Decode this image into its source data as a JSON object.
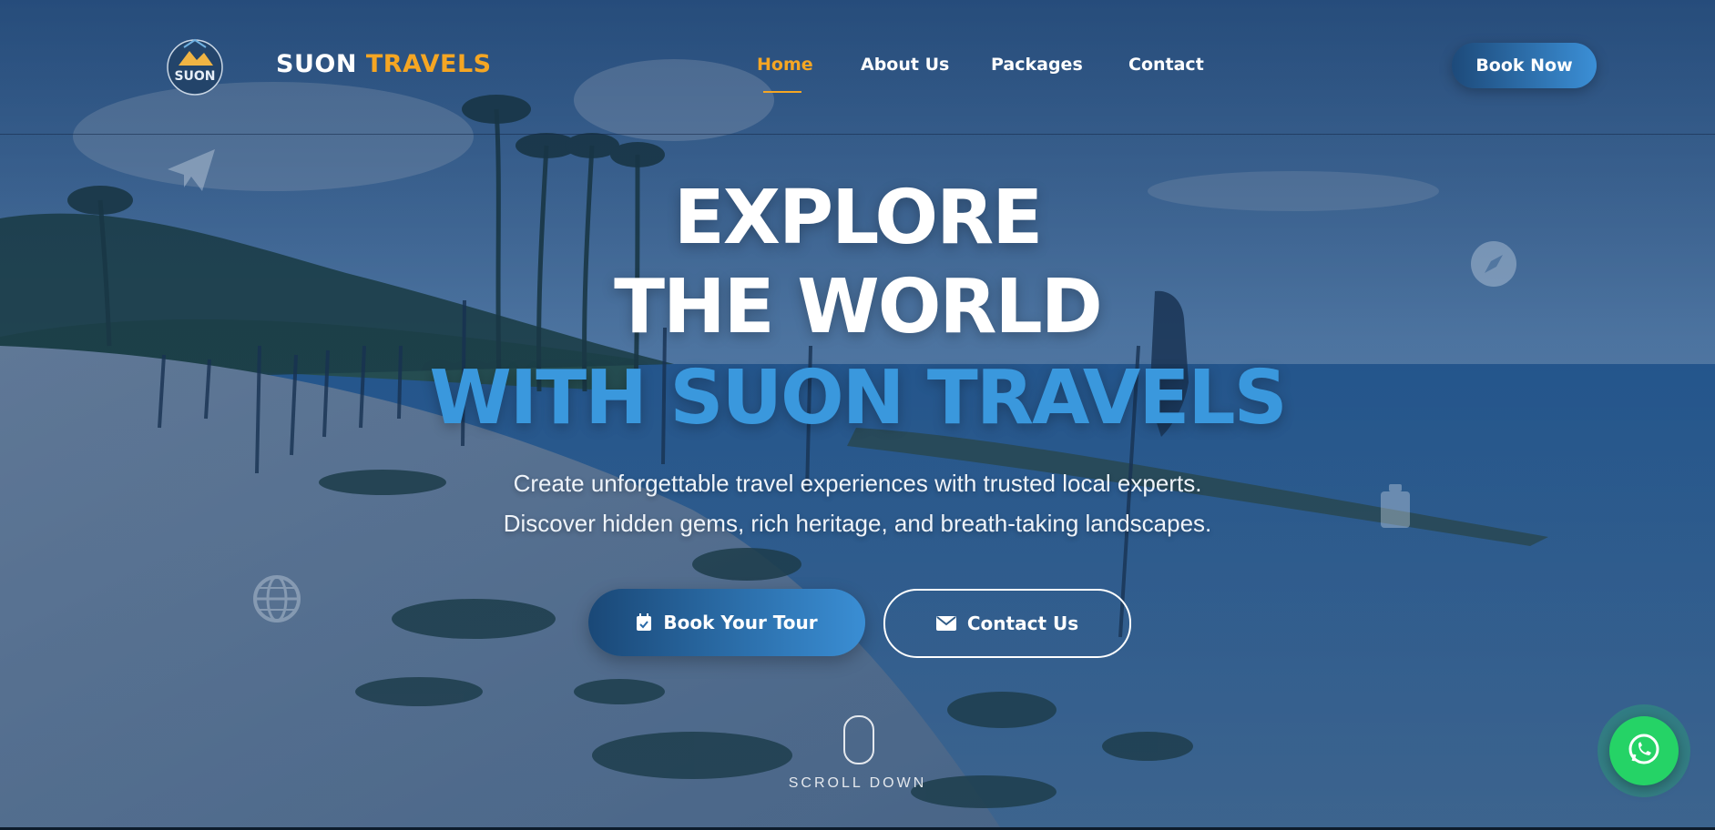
{
  "brand": {
    "name_part1": "SUON",
    "name_part2": "TRAVELS",
    "badge_text": "SUON",
    "accent_color": "#f5a623",
    "primary_blue": "#3a98dd"
  },
  "nav": {
    "links": [
      {
        "label": "Home",
        "active": true
      },
      {
        "label": "About Us",
        "active": false
      },
      {
        "label": "Packages",
        "active": false
      },
      {
        "label": "Contact",
        "active": false
      }
    ],
    "cta_label": "Book Now"
  },
  "hero": {
    "headline_line1": "EXPLORE",
    "headline_line2": "THE WORLD",
    "headline_line3": "WITH SUON TRAVELS",
    "subtitle_line1": "Create unforgettable travel experiences with trusted local experts.",
    "subtitle_line2": "Discover hidden gems, rich heritage, and breath-taking landscapes.",
    "primary_button": {
      "label": "Book Your Tour",
      "icon": "calendar-check-icon"
    },
    "secondary_button": {
      "label": "Contact Us",
      "icon": "envelope-icon"
    },
    "scroll_label": "SCROLL DOWN"
  },
  "floating_icons": [
    "paper-plane-icon",
    "compass-icon",
    "luggage-icon",
    "globe-icon"
  ],
  "whatsapp": {
    "icon": "whatsapp-icon",
    "color": "#25d366"
  }
}
